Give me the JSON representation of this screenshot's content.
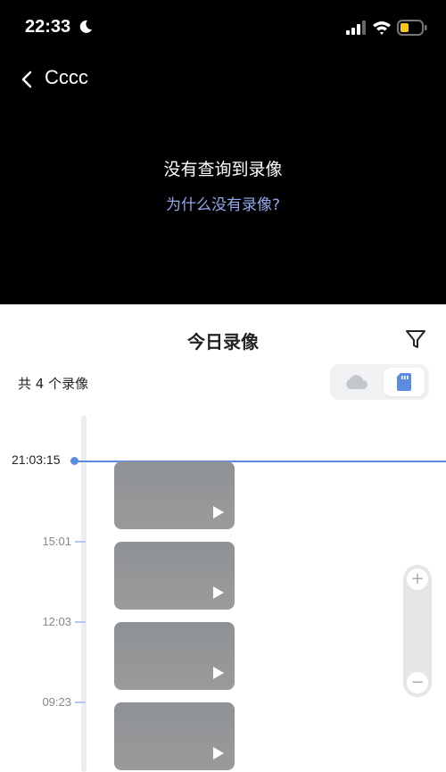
{
  "status_bar": {
    "time": "22:33"
  },
  "nav": {
    "title": "Cccc"
  },
  "player": {
    "empty_message": "没有查询到录像",
    "why_link": "为什么没有录像?"
  },
  "sheet": {
    "title": "今日录像",
    "count": "共 4 个录像",
    "storage_toggle": {
      "options": [
        "cloud",
        "sd-card"
      ],
      "selected": "sd-card"
    }
  },
  "timeline": {
    "current_time": "21:03:15",
    "ticks": [
      "15:01",
      "12:03",
      "09:23"
    ],
    "recordings_count": 4
  },
  "zoom": {
    "plus": "+",
    "minus": "−"
  },
  "colors": {
    "accent": "#5b8ce4",
    "link": "#8fa8ea",
    "sd_icon": "#5b8ce4"
  }
}
